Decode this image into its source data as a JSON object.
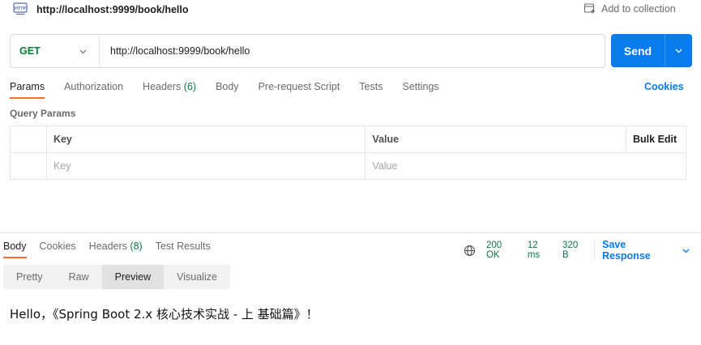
{
  "title_bar": {
    "url": "http://localhost:9999/book/hello",
    "http_icon_label": "HTTP",
    "add_to_collection": "Add to collection"
  },
  "request": {
    "method": "GET",
    "url_value": "http://localhost:9999/book/hello",
    "send_label": "Send"
  },
  "request_tabs": [
    {
      "label": "Params",
      "active": true
    },
    {
      "label": "Authorization"
    },
    {
      "label": "Headers",
      "count": "(6)"
    },
    {
      "label": "Body"
    },
    {
      "label": "Pre-request Script"
    },
    {
      "label": "Tests"
    },
    {
      "label": "Settings"
    }
  ],
  "cookies_link": "Cookies",
  "query_params": {
    "label": "Query Params",
    "headers": {
      "key": "Key",
      "value": "Value",
      "bulk_edit": "Bulk Edit"
    },
    "placeholder": {
      "key": "Key",
      "value": "Value"
    }
  },
  "response_tabs": [
    {
      "label": "Body",
      "active": true
    },
    {
      "label": "Cookies"
    },
    {
      "label": "Headers",
      "count": "(8)"
    },
    {
      "label": "Test Results"
    }
  ],
  "response_status": {
    "status": "200 OK",
    "time": "12 ms",
    "size": "320 B",
    "save_response": "Save Response"
  },
  "view_modes": [
    {
      "label": "Pretty"
    },
    {
      "label": "Raw"
    },
    {
      "label": "Preview",
      "active": true
    },
    {
      "label": "Visualize"
    }
  ],
  "preview_body": "Hello，《Spring Boot 2.x 核心技术实战 - 上 基础篇》！",
  "colors": {
    "accent": "#ff6c37",
    "send_blue": "#097bed",
    "method_green": "#007f31",
    "status_green": "#0c7a45"
  }
}
